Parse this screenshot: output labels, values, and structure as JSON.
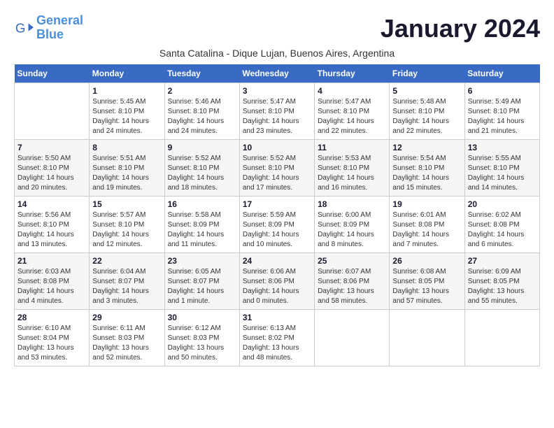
{
  "logo": {
    "line1": "General",
    "line2": "Blue"
  },
  "title": "January 2024",
  "subtitle": "Santa Catalina - Dique Lujan, Buenos Aires, Argentina",
  "days_of_week": [
    "Sunday",
    "Monday",
    "Tuesday",
    "Wednesday",
    "Thursday",
    "Friday",
    "Saturday"
  ],
  "weeks": [
    [
      {
        "day": "",
        "info": ""
      },
      {
        "day": "1",
        "info": "Sunrise: 5:45 AM\nSunset: 8:10 PM\nDaylight: 14 hours\nand 24 minutes."
      },
      {
        "day": "2",
        "info": "Sunrise: 5:46 AM\nSunset: 8:10 PM\nDaylight: 14 hours\nand 24 minutes."
      },
      {
        "day": "3",
        "info": "Sunrise: 5:47 AM\nSunset: 8:10 PM\nDaylight: 14 hours\nand 23 minutes."
      },
      {
        "day": "4",
        "info": "Sunrise: 5:47 AM\nSunset: 8:10 PM\nDaylight: 14 hours\nand 22 minutes."
      },
      {
        "day": "5",
        "info": "Sunrise: 5:48 AM\nSunset: 8:10 PM\nDaylight: 14 hours\nand 22 minutes."
      },
      {
        "day": "6",
        "info": "Sunrise: 5:49 AM\nSunset: 8:10 PM\nDaylight: 14 hours\nand 21 minutes."
      }
    ],
    [
      {
        "day": "7",
        "info": "Sunrise: 5:50 AM\nSunset: 8:10 PM\nDaylight: 14 hours\nand 20 minutes."
      },
      {
        "day": "8",
        "info": "Sunrise: 5:51 AM\nSunset: 8:10 PM\nDaylight: 14 hours\nand 19 minutes."
      },
      {
        "day": "9",
        "info": "Sunrise: 5:52 AM\nSunset: 8:10 PM\nDaylight: 14 hours\nand 18 minutes."
      },
      {
        "day": "10",
        "info": "Sunrise: 5:52 AM\nSunset: 8:10 PM\nDaylight: 14 hours\nand 17 minutes."
      },
      {
        "day": "11",
        "info": "Sunrise: 5:53 AM\nSunset: 8:10 PM\nDaylight: 14 hours\nand 16 minutes."
      },
      {
        "day": "12",
        "info": "Sunrise: 5:54 AM\nSunset: 8:10 PM\nDaylight: 14 hours\nand 15 minutes."
      },
      {
        "day": "13",
        "info": "Sunrise: 5:55 AM\nSunset: 8:10 PM\nDaylight: 14 hours\nand 14 minutes."
      }
    ],
    [
      {
        "day": "14",
        "info": "Sunrise: 5:56 AM\nSunset: 8:10 PM\nDaylight: 14 hours\nand 13 minutes."
      },
      {
        "day": "15",
        "info": "Sunrise: 5:57 AM\nSunset: 8:10 PM\nDaylight: 14 hours\nand 12 minutes."
      },
      {
        "day": "16",
        "info": "Sunrise: 5:58 AM\nSunset: 8:09 PM\nDaylight: 14 hours\nand 11 minutes."
      },
      {
        "day": "17",
        "info": "Sunrise: 5:59 AM\nSunset: 8:09 PM\nDaylight: 14 hours\nand 10 minutes."
      },
      {
        "day": "18",
        "info": "Sunrise: 6:00 AM\nSunset: 8:09 PM\nDaylight: 14 hours\nand 8 minutes."
      },
      {
        "day": "19",
        "info": "Sunrise: 6:01 AM\nSunset: 8:08 PM\nDaylight: 14 hours\nand 7 minutes."
      },
      {
        "day": "20",
        "info": "Sunrise: 6:02 AM\nSunset: 8:08 PM\nDaylight: 14 hours\nand 6 minutes."
      }
    ],
    [
      {
        "day": "21",
        "info": "Sunrise: 6:03 AM\nSunset: 8:08 PM\nDaylight: 14 hours\nand 4 minutes."
      },
      {
        "day": "22",
        "info": "Sunrise: 6:04 AM\nSunset: 8:07 PM\nDaylight: 14 hours\nand 3 minutes."
      },
      {
        "day": "23",
        "info": "Sunrise: 6:05 AM\nSunset: 8:07 PM\nDaylight: 14 hours\nand 1 minute."
      },
      {
        "day": "24",
        "info": "Sunrise: 6:06 AM\nSunset: 8:06 PM\nDaylight: 14 hours\nand 0 minutes."
      },
      {
        "day": "25",
        "info": "Sunrise: 6:07 AM\nSunset: 8:06 PM\nDaylight: 13 hours\nand 58 minutes."
      },
      {
        "day": "26",
        "info": "Sunrise: 6:08 AM\nSunset: 8:05 PM\nDaylight: 13 hours\nand 57 minutes."
      },
      {
        "day": "27",
        "info": "Sunrise: 6:09 AM\nSunset: 8:05 PM\nDaylight: 13 hours\nand 55 minutes."
      }
    ],
    [
      {
        "day": "28",
        "info": "Sunrise: 6:10 AM\nSunset: 8:04 PM\nDaylight: 13 hours\nand 53 minutes."
      },
      {
        "day": "29",
        "info": "Sunrise: 6:11 AM\nSunset: 8:03 PM\nDaylight: 13 hours\nand 52 minutes."
      },
      {
        "day": "30",
        "info": "Sunrise: 6:12 AM\nSunset: 8:03 PM\nDaylight: 13 hours\nand 50 minutes."
      },
      {
        "day": "31",
        "info": "Sunrise: 6:13 AM\nSunset: 8:02 PM\nDaylight: 13 hours\nand 48 minutes."
      },
      {
        "day": "",
        "info": ""
      },
      {
        "day": "",
        "info": ""
      },
      {
        "day": "",
        "info": ""
      }
    ]
  ]
}
